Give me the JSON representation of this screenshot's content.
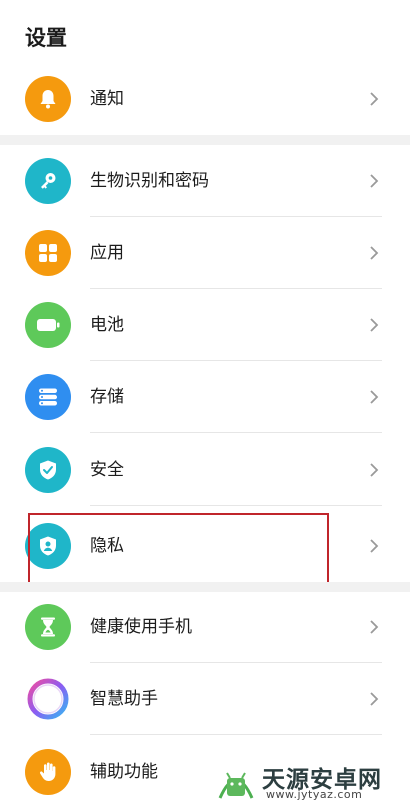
{
  "header": {
    "title": "设置"
  },
  "colors": {
    "orange": "#f59a0e",
    "cyan": "#1fb6c9",
    "green": "#5ec95a",
    "blue": "#2f8ef0",
    "highlight": "#c0252b"
  },
  "items": [
    {
      "label": "通知",
      "icon": "bell-icon"
    },
    {
      "label": "生物识别和密码",
      "icon": "key-icon"
    },
    {
      "label": "应用",
      "icon": "apps-grid-icon"
    },
    {
      "label": "电池",
      "icon": "battery-icon"
    },
    {
      "label": "存储",
      "icon": "storage-icon"
    },
    {
      "label": "安全",
      "icon": "shield-check-icon"
    },
    {
      "label": "隐私",
      "icon": "privacy-icon"
    },
    {
      "label": "健康使用手机",
      "icon": "hourglass-icon"
    },
    {
      "label": "智慧助手",
      "icon": "assistant-ring-icon"
    },
    {
      "label": "辅助功能",
      "icon": "hand-icon"
    }
  ],
  "watermark": {
    "title": "天源安卓网",
    "url": "www.jytyaz.com"
  }
}
